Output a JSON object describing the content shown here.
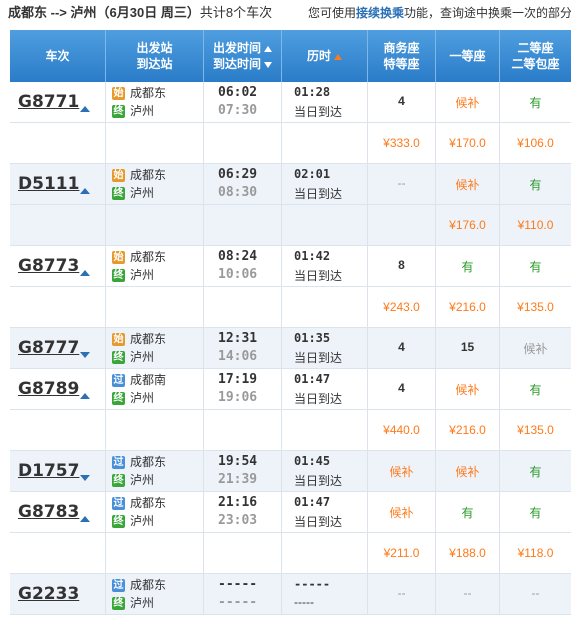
{
  "top": {
    "from": "成都东",
    "arrow": "-->",
    "to": "泸州",
    "date": "（6月30日  周三）",
    "count": "共计8个车次",
    "tip_prefix": "您可使用",
    "tip_link": "接续换乘",
    "tip_suffix": "功能，查询途中换乘一次的部分"
  },
  "headers": {
    "train": "车次",
    "station_1": "出发站",
    "station_2": "到达站",
    "time_1": "出发时间",
    "time_2": "到达时间",
    "duration": "历时",
    "business_1": "商务座",
    "business_2": "特等座",
    "first": "一等座",
    "second_1": "二等座",
    "second_2": "二等包座"
  },
  "trains": [
    {
      "no": "G8771",
      "dir": "up",
      "from_badge": "始",
      "from_badge_type": "start",
      "from": "成都东",
      "to_badge": "终",
      "to": "泸州",
      "dep": "06:02",
      "arr": "07:30",
      "dur": "01:28",
      "dur_note": "当日到达",
      "business": "4",
      "first": "候补",
      "second": "有",
      "prices": {
        "business": "¥333.0",
        "first": "¥170.0",
        "second": "¥106.0"
      }
    },
    {
      "no": "D5111",
      "dir": "up",
      "from_badge": "始",
      "from_badge_type": "start",
      "from": "成都东",
      "to_badge": "终",
      "to": "泸州",
      "dep": "06:29",
      "arr": "08:30",
      "dur": "02:01",
      "dur_note": "当日到达",
      "business": "--",
      "first": "候补",
      "second": "有",
      "prices": {
        "business": "",
        "first": "¥176.0",
        "second": "¥110.0"
      }
    },
    {
      "no": "G8773",
      "dir": "up",
      "from_badge": "始",
      "from_badge_type": "start",
      "from": "成都东",
      "to_badge": "终",
      "to": "泸州",
      "dep": "08:24",
      "arr": "10:06",
      "dur": "01:42",
      "dur_note": "当日到达",
      "business": "8",
      "first": "有",
      "second": "有",
      "prices": {
        "business": "¥243.0",
        "first": "¥216.0",
        "second": "¥135.0"
      }
    },
    {
      "no": "G8777",
      "dir": "down",
      "from_badge": "始",
      "from_badge_type": "start",
      "from": "成都东",
      "to_badge": "终",
      "to": "泸州",
      "dep": "12:31",
      "arr": "14:06",
      "dur": "01:35",
      "dur_note": "当日到达",
      "business": "4",
      "first": "15",
      "second": "候补",
      "prices": null
    },
    {
      "no": "G8789",
      "dir": "up",
      "from_badge": "过",
      "from_badge_type": "pass",
      "from": "成都南",
      "to_badge": "终",
      "to": "泸州",
      "dep": "17:19",
      "arr": "19:06",
      "dur": "01:47",
      "dur_note": "当日到达",
      "business": "4",
      "first": "候补",
      "second": "有",
      "prices": {
        "business": "¥440.0",
        "first": "¥216.0",
        "second": "¥135.0"
      }
    },
    {
      "no": "D1757",
      "dir": "down",
      "from_badge": "过",
      "from_badge_type": "pass",
      "from": "成都东",
      "to_badge": "终",
      "to": "泸州",
      "dep": "19:54",
      "arr": "21:39",
      "dur": "01:45",
      "dur_note": "当日到达",
      "business": "候补",
      "first": "候补",
      "second": "有",
      "prices": null
    },
    {
      "no": "G8783",
      "dir": "up",
      "from_badge": "过",
      "from_badge_type": "pass",
      "from": "成都东",
      "to_badge": "终",
      "to": "泸州",
      "dep": "21:16",
      "arr": "23:03",
      "dur": "01:47",
      "dur_note": "当日到达",
      "business": "候补",
      "first": "有",
      "second": "有",
      "prices": {
        "business": "¥211.0",
        "first": "¥188.0",
        "second": "¥118.0"
      }
    },
    {
      "no": "G2233",
      "dir": "none",
      "from_badge": "过",
      "from_badge_type": "pass",
      "from": "成都东",
      "to_badge": "终",
      "to": "泸州",
      "dep": "-----",
      "arr": "-----",
      "dur": "-----",
      "dur_note": "-----",
      "business": "--",
      "first": "--",
      "second": "--",
      "prices": null
    }
  ],
  "colors": {
    "header": "#3a8bd6",
    "wait": "#ff7a1a",
    "avail": "#2a9a2a",
    "price": "#ff7a1a",
    "badge_start": "#e69a2e",
    "badge_pass": "#4a90d9",
    "badge_end": "#3aa63a"
  }
}
